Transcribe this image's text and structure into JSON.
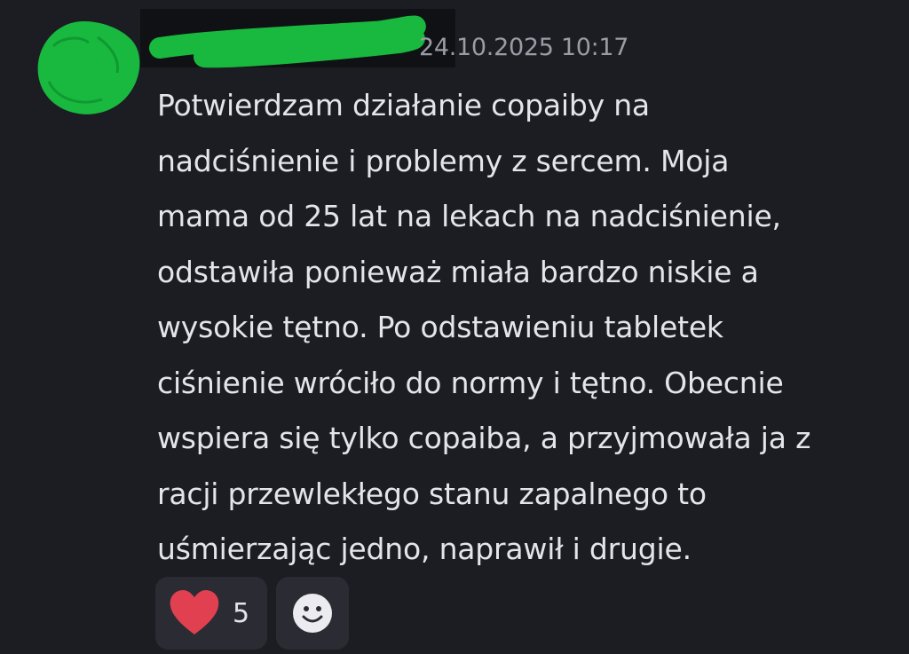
{
  "message": {
    "timestamp": "24.10.2025 10:17",
    "body_lines": [
      "Potwierdzam działanie copaiby na",
      "nadciśnienie i problemy z sercem. Moja",
      "mama od 25 lat na lekach na nadciśnienie,",
      "odstawiła ponieważ miała bardzo niskie a",
      "wysokie tętno. Po odstawieniu tabletek",
      "ciśnienie wróciło do normy i tętno. Obecnie",
      "wspiera się tylko copaiba, a przyjmowała ja z",
      "racji przewlekłego stanu zapalnego to",
      "uśmierzając jedno, naprawił i drugie."
    ]
  },
  "reactions": [
    {
      "icon": "heart-icon",
      "count": "5",
      "color": "#e0404f"
    },
    {
      "icon": "add-reaction-smiley-icon"
    }
  ],
  "colors": {
    "background": "#1c1d23",
    "redaction_marker": "#19b83f",
    "reaction_bg": "#2b2c33"
  }
}
